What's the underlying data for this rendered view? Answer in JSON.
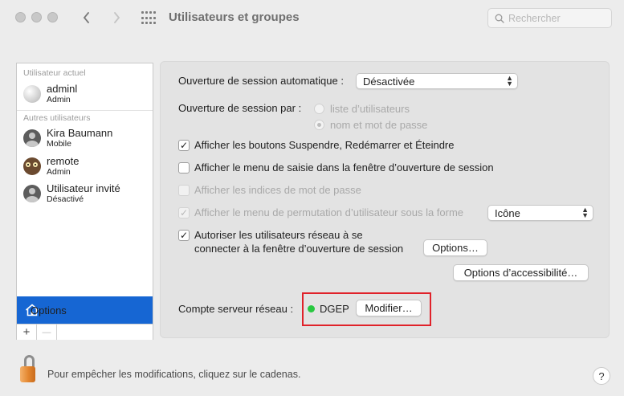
{
  "window": {
    "title": "Utilisateurs et groupes",
    "search_placeholder": "Rechercher"
  },
  "sidebar": {
    "current_user_label": "Utilisateur actuel",
    "other_users_label": "Autres utilisateurs",
    "users": [
      {
        "name": "adminl",
        "role": "Admin",
        "avatar": "golf-ball-icon"
      },
      {
        "name": "Kira Baumann",
        "role": "Mobile",
        "avatar": "person-icon"
      },
      {
        "name": "remote",
        "role": "Admin",
        "avatar": "owl-icon"
      },
      {
        "name": "Utilisateur invité",
        "role": "Désactivé",
        "avatar": "person-icon"
      }
    ],
    "options_label": "Options",
    "add_label": "+",
    "remove_label": "—"
  },
  "login": {
    "auto_login_label": "Ouverture de session automatique :",
    "auto_login_value": "Désactivée",
    "display_as_label": "Ouverture de session par :",
    "radio_list": "liste d’utilisateurs",
    "radio_name_password": "nom et mot de passe",
    "radio_selected": "nom et mot de passe",
    "cb_sleep_restart": "Afficher les boutons Suspendre, Redémarrer et Éteindre",
    "cb_input_menu": "Afficher le menu de saisie dans la fenêtre d’ouverture de session",
    "cb_password_hints": "Afficher les indices de mot de passe",
    "cb_fast_switch": "Afficher le menu de permutation d’utilisateur sous la forme",
    "fast_switch_value": "Icône",
    "cb_network_users_line1": "Autoriser les utilisateurs réseau à se",
    "cb_network_users_line2": "connecter à la fenêtre d’ouverture de session",
    "options_button": "Options…",
    "accessibility_button": "Options d’accessibilité…",
    "network_server_label": "Compte serveur réseau :",
    "network_server_value": "DGEP",
    "network_server_status": "connected",
    "modify_button": "Modifier…",
    "checked": {
      "sleep_restart": true,
      "input_menu": false,
      "password_hints": false,
      "fast_switch": true,
      "network_users": true
    }
  },
  "footer": {
    "lock_text": "Pour empêcher les modifications, cliquez sur le cadenas.",
    "help_label": "?"
  },
  "colors": {
    "accent": "#1666d3",
    "status_green": "#28c840",
    "highlight_red": "#e0222a",
    "lock_orange": "#e2852e"
  }
}
